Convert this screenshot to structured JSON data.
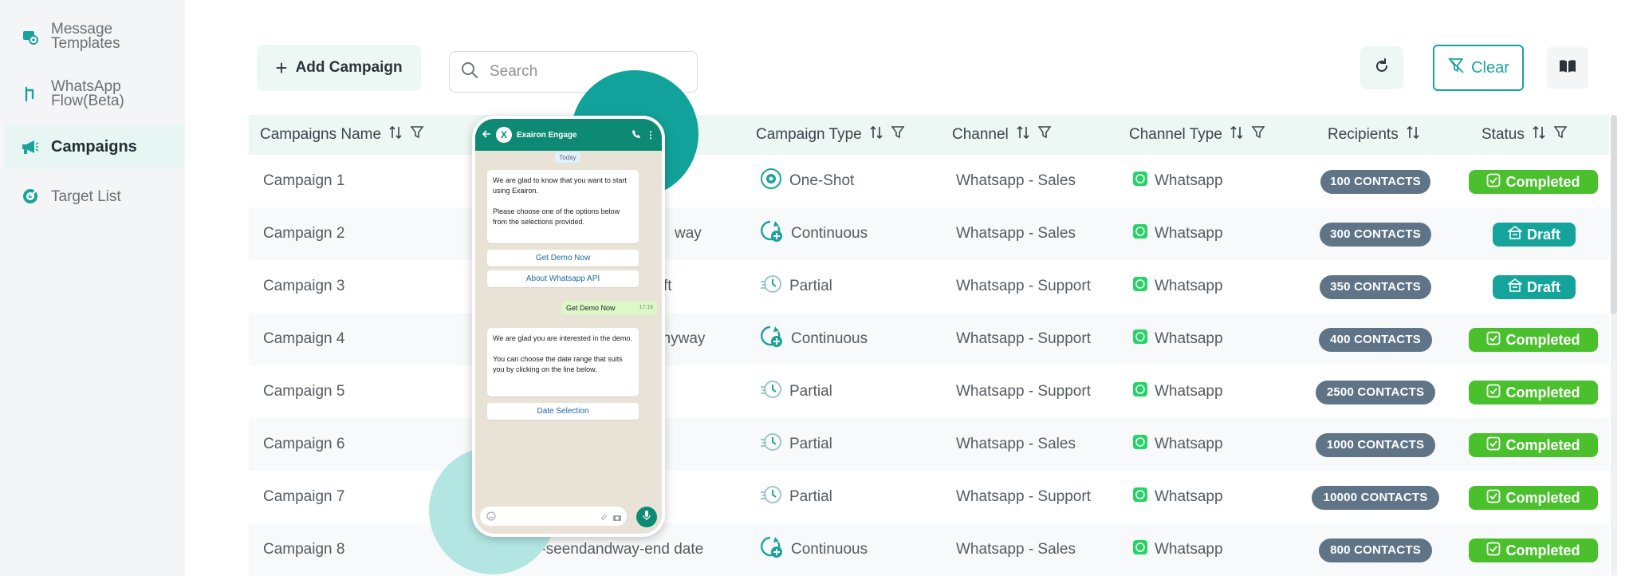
{
  "sidebar": {
    "items": [
      {
        "label": "Message Templates",
        "icon": "message-template-icon"
      },
      {
        "label": "WhatsApp Flow(Beta)",
        "icon": "flow-icon"
      },
      {
        "label": "Campaigns",
        "icon": "megaphone-icon",
        "active": true
      },
      {
        "label": "Target List",
        "icon": "target-icon"
      }
    ]
  },
  "toolbar": {
    "add_label": "Add Campaign",
    "search_placeholder": "Search",
    "clear_label": "Clear"
  },
  "table": {
    "headers": [
      "Campaigns Name",
      "Campaign Type",
      "Channel",
      "Channel Type",
      "Recipients",
      "Status"
    ],
    "rows": [
      {
        "name": "Campaign 1",
        "template": "",
        "type": "One-Shot",
        "channel": "Whatsapp - Sales",
        "channel_type": "Whatsapp",
        "recipients": "100 CONTACTS",
        "status": "Completed"
      },
      {
        "name": "Campaign 2",
        "template": "way",
        "type": "Continuous",
        "channel": "Whatsapp - Sales",
        "channel_type": "Whatsapp",
        "recipients": "300 CONTACTS",
        "status": "Draft"
      },
      {
        "name": "Campaign 3",
        "template": "ft",
        "type": "Partial",
        "channel": "Whatsapp - Support",
        "channel_type": "Whatsapp",
        "recipients": "350 CONTACTS",
        "status": "Draft"
      },
      {
        "name": "Campaign 4",
        "template": "anyway",
        "type": "Continuous",
        "channel": "Whatsapp - Support",
        "channel_type": "Whatsapp",
        "recipients": "400 CONTACTS",
        "status": "Completed"
      },
      {
        "name": "Campaign 5",
        "template": "",
        "type": "Partial",
        "channel": "Whatsapp - Support",
        "channel_type": "Whatsapp",
        "recipients": "2500 CONTACTS",
        "status": "Completed"
      },
      {
        "name": "Campaign 6",
        "template": "",
        "type": "Partial",
        "channel": "Whatsapp - Sales",
        "channel_type": "Whatsapp",
        "recipients": "1000 CONTACTS",
        "status": "Completed"
      },
      {
        "name": "Campaign 7",
        "template": "",
        "type": "Partial",
        "channel": "Whatsapp - Support",
        "channel_type": "Whatsapp",
        "recipients": "10000 CONTACTS",
        "status": "Completed"
      },
      {
        "name": "Campaign 8",
        "template": "continous-seendandway-end date",
        "type": "Continuous",
        "channel": "Whatsapp - Sales",
        "channel_type": "Whatsapp",
        "recipients": "800 CONTACTS",
        "status": "Completed"
      }
    ]
  },
  "phone": {
    "brand": "Exairon Engage",
    "logo_letter": "X",
    "day": "Today",
    "msg1": "We are glad to know that you want to start using Exairon.",
    "msg1b": "Please choose one of the options below from the selections provided.",
    "btn1": "Get Demo Now",
    "btn2": "About Whatsapp API",
    "out_msg": "Get Demo Now",
    "out_time": "17:16",
    "msg2": "We are glad you are interested in the demo.",
    "msg2b": "You can choose the date range that suits you by clicking on the line below.",
    "btn3": "Date Selection"
  },
  "colors": {
    "accent": "#1aa39a",
    "completed": "#4bc02d",
    "draft": "#14a49b",
    "badge": "#5f7487",
    "whatsapp": "#25d366"
  }
}
